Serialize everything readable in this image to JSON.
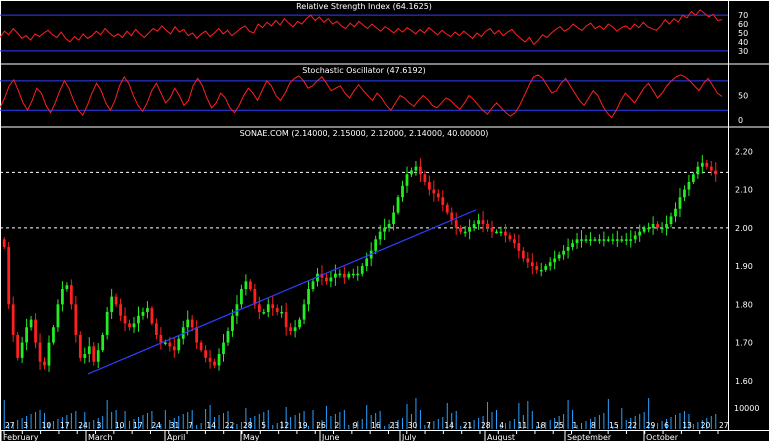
{
  "chart_data": [
    {
      "type": "line",
      "title": "Relative Strength Index (64.1625)",
      "y_ticks": [
        "70",
        "60",
        "50",
        "40",
        "30"
      ],
      "reference_lines": [
        70,
        30
      ],
      "ylim": [
        22,
        78
      ],
      "current_value": 64.1625,
      "series": [
        {
          "color": "#ff2020",
          "values": [
            45,
            52,
            48,
            55,
            50,
            44,
            47,
            42,
            49,
            46,
            50,
            53,
            48,
            45,
            51,
            44,
            40,
            46,
            42,
            49,
            44,
            47,
            52,
            48,
            55,
            50,
            46,
            49,
            45,
            52,
            47,
            54,
            49,
            45,
            50,
            55,
            52,
            58,
            53,
            49,
            57,
            51,
            54,
            47,
            50,
            44,
            49,
            52,
            46,
            50,
            55,
            49,
            53,
            47,
            51,
            55,
            58,
            52,
            50,
            60,
            56,
            62,
            58,
            64,
            59,
            66,
            61,
            57,
            63,
            60,
            66,
            70,
            64,
            68,
            62,
            66,
            60,
            63,
            58,
            55,
            61,
            57,
            63,
            59,
            55,
            60,
            56,
            52,
            57,
            54,
            50,
            55,
            51,
            56,
            53,
            49,
            54,
            50,
            56,
            52,
            48,
            53,
            49,
            46,
            51,
            47,
            52,
            48,
            44,
            50,
            46,
            52,
            55,
            49,
            53,
            47,
            51,
            54,
            48,
            44,
            40,
            45,
            37,
            42,
            48,
            45,
            50,
            54,
            57,
            52,
            55,
            60,
            56,
            53,
            58,
            61,
            55,
            58,
            54,
            60,
            57,
            52,
            56,
            58,
            54,
            60,
            56,
            62,
            57,
            55,
            53,
            58,
            65,
            60,
            66,
            62,
            70,
            67,
            74,
            70,
            76,
            72,
            68,
            71,
            64,
            65
          ]
        }
      ]
    },
    {
      "type": "line",
      "title": "Stochastic Oscillator (47.6192)",
      "y_ticks": [
        "50",
        "0"
      ],
      "reference_lines": [
        80,
        20
      ],
      "ylim": [
        -8,
        98
      ],
      "current_value": 47.6192,
      "series": [
        {
          "color": "#ff2020",
          "values": [
            25,
            45,
            70,
            82,
            60,
            35,
            20,
            40,
            65,
            55,
            30,
            15,
            35,
            60,
            80,
            65,
            40,
            20,
            10,
            30,
            55,
            75,
            60,
            35,
            20,
            40,
            70,
            88,
            75,
            50,
            30,
            18,
            35,
            60,
            75,
            55,
            35,
            45,
            65,
            50,
            30,
            40,
            70,
            85,
            70,
            45,
            25,
            35,
            55,
            45,
            25,
            15,
            30,
            50,
            65,
            55,
            40,
            60,
            80,
            70,
            50,
            40,
            55,
            75,
            85,
            90,
            80,
            65,
            70,
            80,
            88,
            75,
            60,
            65,
            70,
            55,
            45,
            60,
            72,
            60,
            50,
            40,
            55,
            45,
            30,
            20,
            35,
            50,
            45,
            35,
            28,
            40,
            50,
            42,
            30,
            25,
            35,
            45,
            40,
            30,
            22,
            35,
            50,
            42,
            30,
            20,
            12,
            25,
            35,
            25,
            15,
            8,
            15,
            30,
            50,
            70,
            88,
            92,
            85,
            70,
            55,
            60,
            75,
            85,
            70,
            55,
            40,
            30,
            45,
            60,
            50,
            30,
            15,
            5,
            20,
            40,
            55,
            45,
            35,
            50,
            65,
            75,
            60,
            45,
            55,
            70,
            80,
            88,
            92,
            88,
            80,
            70,
            60,
            75,
            85,
            70,
            55,
            48
          ]
        }
      ]
    },
    {
      "type": "candlestick",
      "title": "SONAE.COM (2.14000, 2.15000, 2.12000, 2.14000, 40.00000)",
      "ylim": [
        1.555,
        2.235
      ],
      "y_ticks": [
        "2.20",
        "2.10",
        "2.00",
        "1.90",
        "1.80",
        "1.70",
        "1.60"
      ],
      "reference_lines": [
        2.145,
        2.0
      ],
      "trendline": [
        [
          1.618,
          0
        ],
        [
          2.047,
          1
        ]
      ],
      "volume_axis_label": "10000",
      "x_tick_labels": [
        "27",
        "3",
        "10",
        "17",
        "24",
        "3",
        "10",
        "17",
        "24",
        "31",
        "7",
        "14",
        "22",
        "28",
        "5",
        "12",
        "19",
        "26",
        "2",
        "9",
        "16",
        "23",
        "30",
        "7",
        "14",
        "21",
        "28",
        "4",
        "11",
        "18",
        "25",
        "1",
        "8",
        "15",
        "22",
        "29",
        "6",
        "13",
        "20",
        "27"
      ],
      "month_labels": [
        "February",
        "March",
        "April",
        "May",
        "June",
        "July",
        "August",
        "September",
        "October"
      ],
      "closes": [
        1.95,
        1.8,
        1.72,
        1.66,
        1.7,
        1.74,
        1.76,
        1.7,
        1.65,
        1.64,
        1.7,
        1.74,
        1.8,
        1.84,
        1.85,
        1.8,
        1.72,
        1.66,
        1.67,
        1.69,
        1.65,
        1.68,
        1.72,
        1.78,
        1.82,
        1.8,
        1.77,
        1.75,
        1.74,
        1.75,
        1.77,
        1.78,
        1.79,
        1.75,
        1.72,
        1.7,
        1.7,
        1.69,
        1.68,
        1.71,
        1.74,
        1.76,
        1.74,
        1.7,
        1.68,
        1.66,
        1.65,
        1.64,
        1.67,
        1.7,
        1.73,
        1.77,
        1.8,
        1.84,
        1.86,
        1.84,
        1.8,
        1.78,
        1.78,
        1.8,
        1.79,
        1.78,
        1.78,
        1.74,
        1.73,
        1.74,
        1.76,
        1.8,
        1.84,
        1.86,
        1.88,
        1.87,
        1.86,
        1.87,
        1.88,
        1.88,
        1.87,
        1.88,
        1.88,
        1.88,
        1.9,
        1.92,
        1.94,
        1.97,
        1.99,
        2.0,
        2.01,
        2.04,
        2.08,
        2.11,
        2.14,
        2.15,
        2.16,
        2.14,
        2.12,
        2.1,
        2.09,
        2.08,
        2.06,
        2.04,
        2.02,
        2.0,
        1.99,
        1.99,
        2.0,
        2.01,
        2.02,
        2.01,
        2.0,
        1.99,
        1.99,
        1.99,
        1.98,
        1.97,
        1.96,
        1.94,
        1.92,
        1.91,
        1.9,
        1.89,
        1.89,
        1.9,
        1.91,
        1.92,
        1.93,
        1.94,
        1.95,
        1.96,
        1.97,
        1.97,
        1.97,
        1.97,
        1.97,
        1.97,
        1.97,
        1.97,
        1.97,
        1.97,
        1.97,
        1.97,
        1.97,
        1.98,
        1.99,
        2.0,
        2.0,
        2.01,
        2.0,
        2.0,
        2.01,
        2.03,
        2.05,
        2.08,
        2.1,
        2.12,
        2.14,
        2.16,
        2.17,
        2.16,
        2.15,
        2.14
      ]
    }
  ]
}
